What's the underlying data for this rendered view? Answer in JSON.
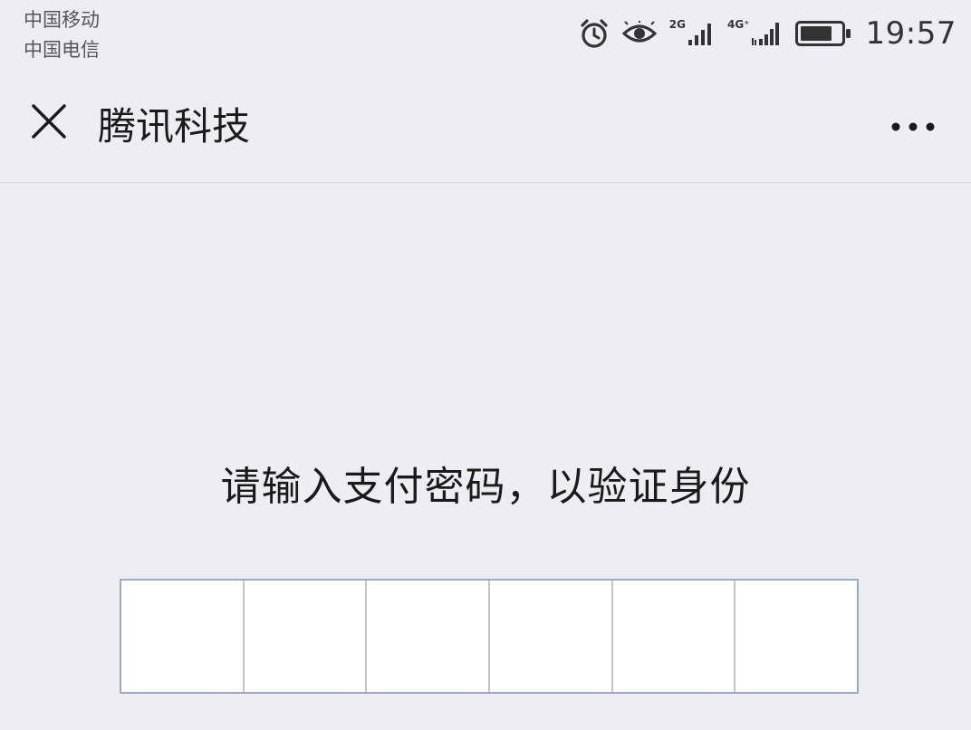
{
  "status_bar": {
    "carrier_1": "中国移动",
    "carrier_2": "中国电信",
    "network_1": "2G",
    "network_2": "4G⁺",
    "time": "19:57",
    "icons": [
      "alarm-icon",
      "eye-icon",
      "signal-2g-icon",
      "signal-4g-icon",
      "battery-icon"
    ]
  },
  "header": {
    "title": "腾讯科技",
    "close_icon": "close-icon",
    "more_icon": "more-dots-icon"
  },
  "main": {
    "prompt": "请输入支付密码，以验证身份",
    "pin_length": 6,
    "pin_values": [
      "",
      "",
      "",
      "",
      "",
      ""
    ]
  },
  "colors": {
    "background": "#efedf4",
    "pin_border": "#9ca9bf",
    "pin_divider": "#c4c4c8",
    "text": "#1a1a1a"
  }
}
